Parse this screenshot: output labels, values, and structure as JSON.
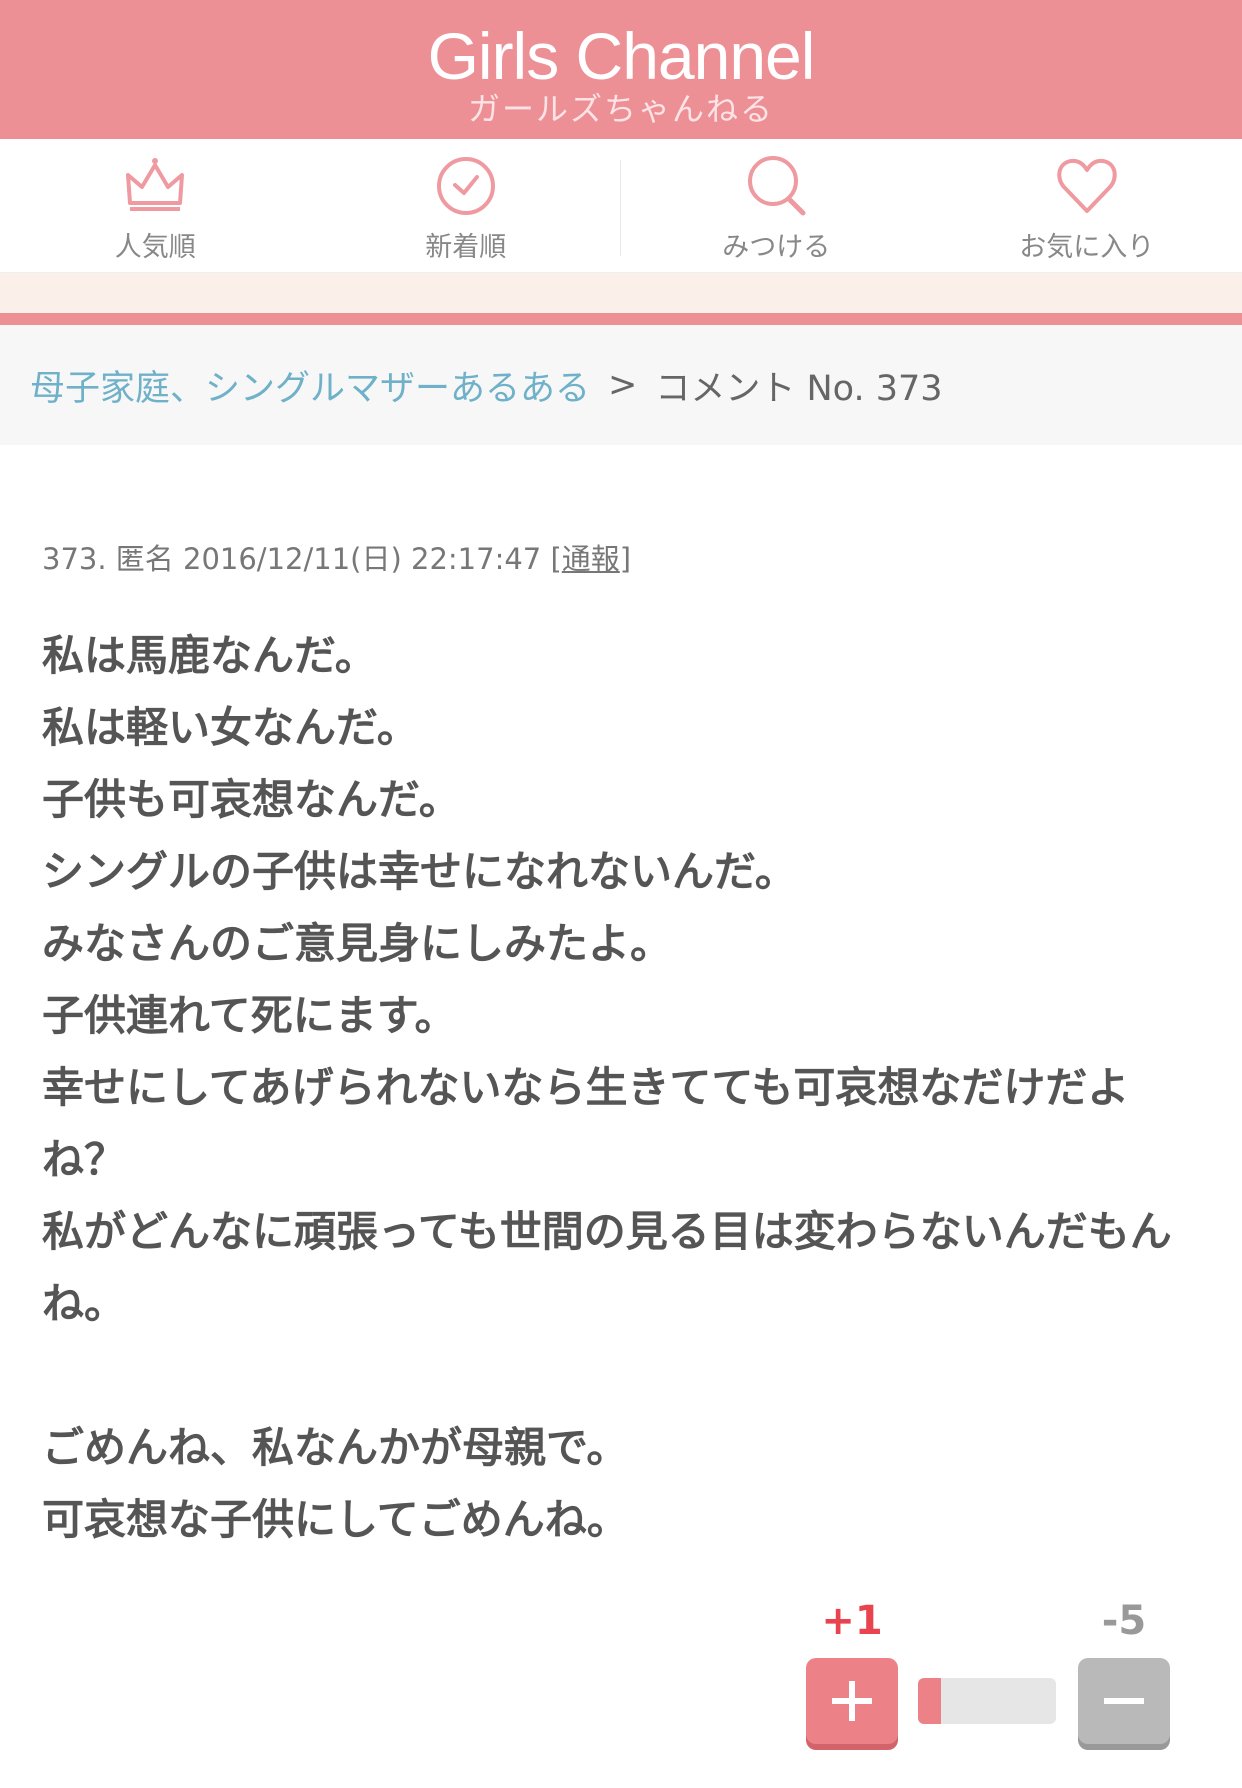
{
  "header": {
    "logo_en": "Girls Channel",
    "logo_jp": "ガールズちゃんねる",
    "accent_color": "#ec9096"
  },
  "nav": [
    {
      "label": "人気順",
      "icon": "crown-icon"
    },
    {
      "label": "新着順",
      "icon": "clock-icon"
    },
    {
      "label": "みつける",
      "icon": "search-icon"
    },
    {
      "label": "お気に入り",
      "icon": "heart-icon"
    }
  ],
  "breadcrumb": {
    "topic": "母子家庭、シングルマザーあるある",
    "separator": ">",
    "current": "コメント No. 373"
  },
  "comment": {
    "meta": "373. 匿名 2016/12/11(日) 22:17:47 [",
    "report_label": "通報",
    "meta_close": "]",
    "lines": [
      "私は馬鹿なんだ。",
      "私は軽い女なんだ。",
      "子供も可哀想なんだ。",
      "シングルの子供は幸せになれないんだ。",
      "みなさんのご意見身にしみたよ。",
      "子供連れて死にます。",
      "幸せにしてあげられないなら生きてても可哀想なだけだよね？",
      "私がどんなに頑張っても世間の見る目は変わらないんだもんね。",
      "",
      "ごめんね、私なんかが母親で。",
      "可哀想な子供にしてごめんね。"
    ]
  },
  "vote": {
    "plus_count": "+1",
    "minus_count": "-5",
    "plus_fraction": 0.167,
    "plus_color": "#e8434e",
    "minus_color": "#999999"
  }
}
